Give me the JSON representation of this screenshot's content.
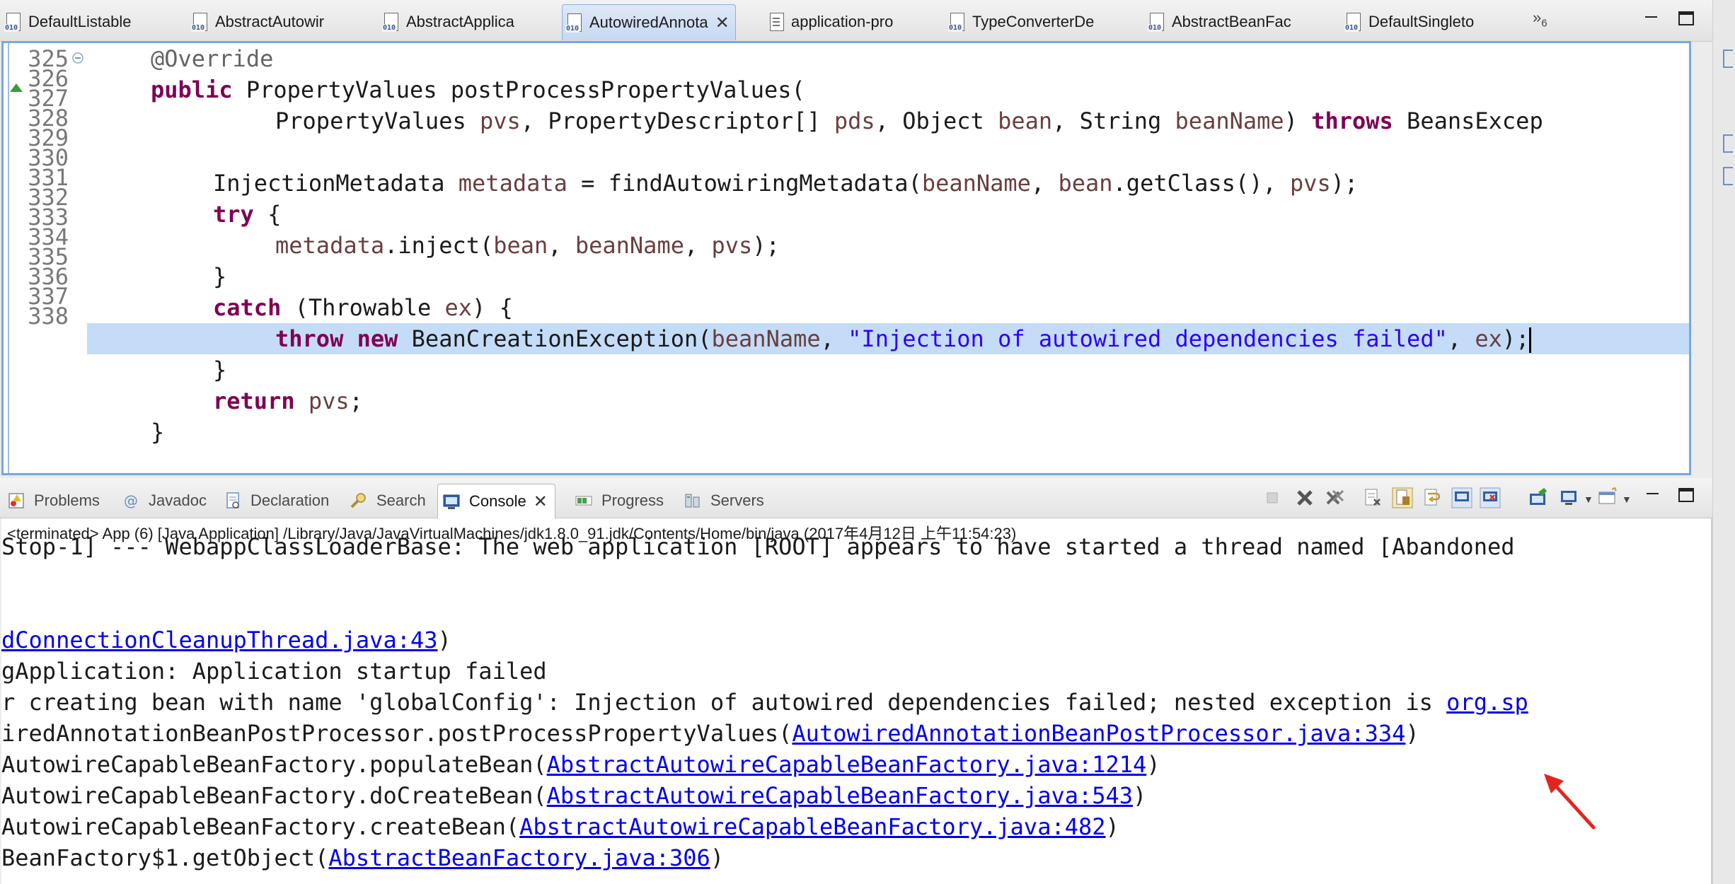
{
  "editor_tabs": [
    {
      "label": "DefaultListable",
      "icon": "java-class-file-icon"
    },
    {
      "label": "AbstractAutowir",
      "icon": "java-class-file-icon"
    },
    {
      "label": "AbstractApplica",
      "icon": "java-class-file-icon"
    },
    {
      "label": "AutowiredAnnota",
      "icon": "java-class-file-icon",
      "active": true
    },
    {
      "label": "application-pro",
      "icon": "text-file-icon"
    },
    {
      "label": "TypeConverterDe",
      "icon": "java-class-file-icon"
    },
    {
      "label": "AbstractBeanFac",
      "icon": "java-class-file-icon"
    },
    {
      "label": "DefaultSingleto",
      "icon": "java-class-file-icon"
    }
  ],
  "editor_overflow": {
    "chevron": "»",
    "count": "6"
  },
  "code": {
    "line_numbers": [
      "325",
      "326",
      "327",
      "328",
      "329",
      "330",
      "331",
      "332",
      "333",
      "334",
      "335",
      "336",
      "337",
      "338"
    ],
    "highlighted_line": "334",
    "l325": "@Override",
    "l326_kw": "public",
    "l326_rest": " PropertyValues postProcessPropertyValues(",
    "l327_t1": "PropertyValues ",
    "l327_v1": "pvs",
    "l327_t2": ", PropertyDescriptor[] ",
    "l327_v2": "pds",
    "l327_t3": ", Object ",
    "l327_v3": "bean",
    "l327_t4": ", String ",
    "l327_v4": "beanName",
    "l327_t5": ") ",
    "l327_kw": "throws",
    "l327_t6": " BeansExcep",
    "l329_t1": "InjectionMetadata ",
    "l329_v1": "metadata",
    "l329_t2": " = findAutowiringMetadata(",
    "l329_v2": "beanName",
    "l329_t3": ", ",
    "l329_v3": "bean",
    "l329_t4": ".getClass(), ",
    "l329_v4": "pvs",
    "l329_t5": ");",
    "l330_kw": "try",
    "l330_t1": " {",
    "l331_v1": "metadata",
    "l331_t1": ".inject(",
    "l331_v2": "bean",
    "l331_t2": ", ",
    "l331_v3": "beanName",
    "l331_t3": ", ",
    "l331_v4": "pvs",
    "l331_t4": ");",
    "l332": "}",
    "l333_kw": "catch",
    "l333_t1": " (Throwable ",
    "l333_v1": "ex",
    "l333_t2": ") {",
    "l334_kw1": "throw",
    "l334_sp": " ",
    "l334_kw2": "new",
    "l334_t1": " BeanCreationException(",
    "l334_v1": "beanName",
    "l334_t2": ", ",
    "l334_str": "\"Injection of autowired dependencies failed\"",
    "l334_t3": ", ",
    "l334_v2": "ex",
    "l334_t4": ");",
    "l335": "}",
    "l336_kw": "return",
    "l336_t1": " ",
    "l336_v1": "pvs",
    "l336_t2": ";",
    "l337": "}"
  },
  "view_tabs": [
    {
      "label": "Problems",
      "icon": "problems-icon"
    },
    {
      "label": "Javadoc",
      "icon": "javadoc-icon"
    },
    {
      "label": "Declaration",
      "icon": "declaration-icon"
    },
    {
      "label": "Search",
      "icon": "search-icon"
    },
    {
      "label": "Console",
      "icon": "console-icon",
      "active": true
    },
    {
      "label": "Progress",
      "icon": "progress-icon"
    },
    {
      "label": "Servers",
      "icon": "servers-icon"
    }
  ],
  "console": {
    "status": "<terminated> App (6) [Java Application] /Library/Java/JavaVirtualMachines/jdk1.8.0_91.jdk/Contents/Home/bin/java (2017年4月12日 上午11:54:23)",
    "line1": "Stop-1] --- WebappClassLoaderBase: The web application [ROOT] appears to have started a thread named [Abandoned",
    "line2_link": "dConnectionCleanupThread.java:43",
    "line2_end": ")",
    "line3": "gApplication: Application startup failed",
    "line4_text": "r creating bean with name 'globalConfig': Injection of autowired dependencies failed; nested exception is ",
    "line4_link": "org.sp",
    "line5_text": "iredAnnotationBeanPostProcessor.postProcessPropertyValues(",
    "line5_link": "AutowiredAnnotationBeanPostProcessor.java:334",
    "line5_end": ")",
    "line6_text": "AutowireCapableBeanFactory.populateBean(",
    "line6_link": "AbstractAutowireCapableBeanFactory.java:1214",
    "line6_end": ")",
    "line7_text": "AutowireCapableBeanFactory.doCreateBean(",
    "line7_link": "AbstractAutowireCapableBeanFactory.java:543",
    "line7_end": ")",
    "line8_text": "AutowireCapableBeanFactory.createBean(",
    "line8_link": "AbstractAutowireCapableBeanFactory.java:482",
    "line8_end": ")",
    "line9_text": "BeanFactory$1.getObject(",
    "line9_link": "AbstractBeanFactory.java:306",
    "line9_end": ")"
  },
  "colors": {
    "keyword": "#7f0055",
    "string": "#2a00ff",
    "variable": "#6a3e3e",
    "annotation": "#646464",
    "link": "#0000ee",
    "line_highlight": "#c4dcf7",
    "focus_border": "#75a7e5",
    "arrow": "#e0261f"
  }
}
